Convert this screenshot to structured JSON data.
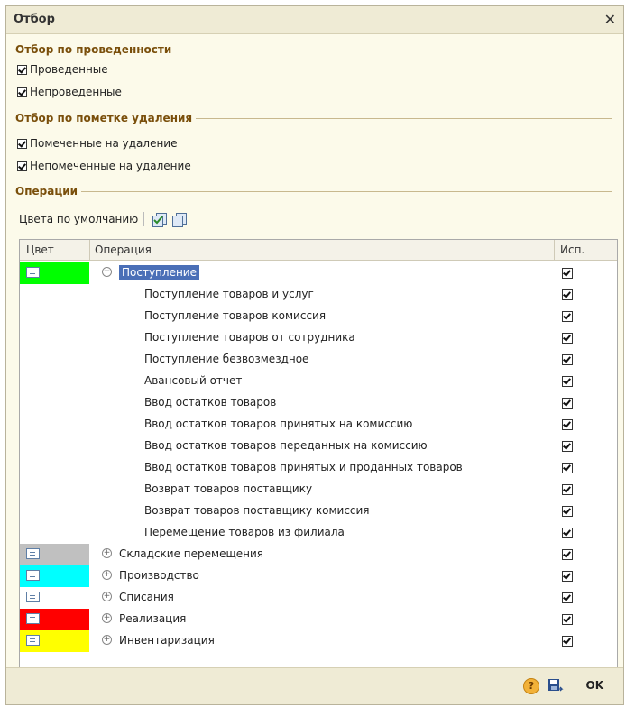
{
  "window": {
    "title": "Отбор"
  },
  "groups": [
    {
      "title": "Отбор по проведенности",
      "items": [
        "Проведенные",
        "Непроведенные"
      ]
    },
    {
      "title": "Отбор по пометке удаления",
      "items": [
        "Помеченные на удаление",
        "Непомеченные на удаление"
      ]
    },
    {
      "title": "Операции"
    }
  ],
  "toolbar": {
    "default_colors_label": "Цвета по умолчанию"
  },
  "table": {
    "headers": [
      "Цвет",
      "Операция",
      "Исп."
    ],
    "rows": [
      {
        "label": "Поступление",
        "color": "#00ff00",
        "checked": true
      },
      {
        "label": "Поступление товаров и услуг",
        "color": "",
        "checked": true
      },
      {
        "label": "Поступление товаров комиссия",
        "color": "",
        "checked": true
      },
      {
        "label": "Поступление товаров от сотрудника",
        "color": "",
        "checked": true
      },
      {
        "label": "Поступление безвозмездное",
        "color": "",
        "checked": true
      },
      {
        "label": "Авансовый отчет",
        "color": "",
        "checked": true
      },
      {
        "label": "Ввод остатков товаров",
        "color": "",
        "checked": true
      },
      {
        "label": "Ввод остатков товаров принятых на комиссию",
        "color": "",
        "checked": true
      },
      {
        "label": "Ввод остатков товаров переданных на комиссию",
        "color": "",
        "checked": true
      },
      {
        "label": "Ввод остатков товаров принятых и проданных товаров",
        "color": "",
        "checked": true
      },
      {
        "label": "Возврат товаров поставщику",
        "color": "",
        "checked": true
      },
      {
        "label": "Возврат товаров поставщику комиссия",
        "color": "",
        "checked": true
      },
      {
        "label": "Перемещение товаров из филиала",
        "color": "",
        "checked": true
      },
      {
        "label": "Складские перемещения",
        "color": "#c0c0c0",
        "checked": true
      },
      {
        "label": "Производство",
        "color": "#00ffff",
        "checked": true
      },
      {
        "label": "Списания",
        "color": "#ffffff",
        "checked": true
      },
      {
        "label": "Реализация",
        "color": "#ff0000",
        "checked": true
      },
      {
        "label": "Инвентаризация",
        "color": "#ffff00",
        "checked": true
      }
    ]
  },
  "footer": {
    "ok_label": "OK",
    "help_label": "?"
  }
}
